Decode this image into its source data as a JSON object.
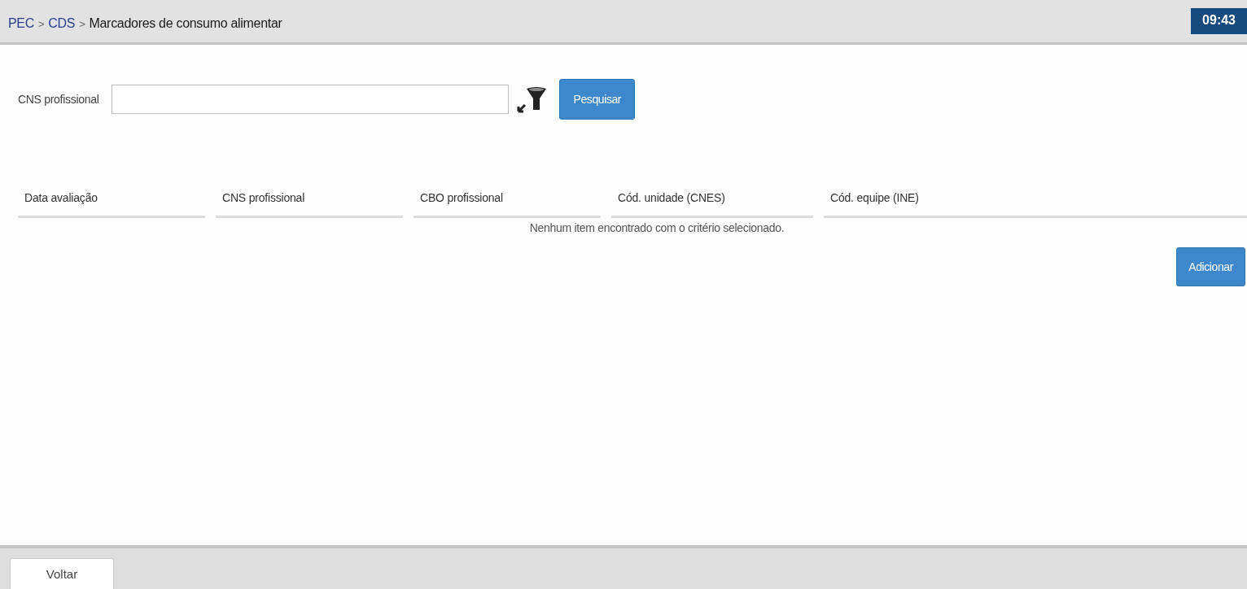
{
  "header": {
    "breadcrumb": [
      {
        "label": "PEC",
        "kind": "link"
      },
      {
        "label": ">",
        "kind": "separator"
      },
      {
        "label": "CDS",
        "kind": "link"
      },
      {
        "label": ">",
        "kind": "separator"
      },
      {
        "label": "Marcadores de consumo alimentar",
        "kind": "current"
      }
    ],
    "clock": "09:43"
  },
  "search": {
    "label": "CNS profissional",
    "button": "Pesquisar"
  },
  "table": {
    "columns": [
      "Data avaliação",
      "CNS profissional",
      "CBO profissional",
      "Cód. unidade (CNES)",
      "Cód. equipe (INE)"
    ],
    "empty_message": "Nenhum item encontrado com o critério selecionado."
  },
  "add_button": "Adicionar",
  "footer": {
    "tabs": [
      {
        "label": "Voltar",
        "selected": true
      }
    ]
  }
}
